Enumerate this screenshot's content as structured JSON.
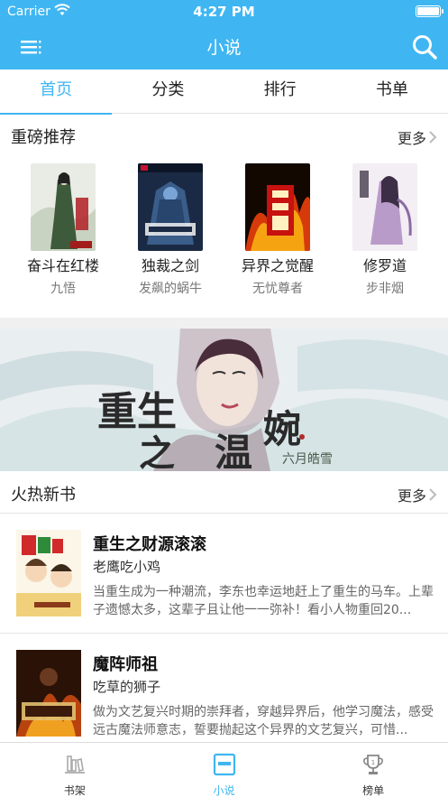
{
  "status_bar": {
    "carrier": "Carrier",
    "time": "4:27 PM"
  },
  "nav": {
    "title": "小说"
  },
  "tabs": [
    {
      "label": "首页",
      "active": true
    },
    {
      "label": "分类",
      "active": false
    },
    {
      "label": "排行",
      "active": false
    },
    {
      "label": "书单",
      "active": false
    }
  ],
  "featured": {
    "title": "重磅推荐",
    "more": "更多",
    "books": [
      {
        "title": "奋斗在红楼",
        "author": "九悟"
      },
      {
        "title": "独裁之剑",
        "author": "发飙的蜗牛"
      },
      {
        "title": "异界之觉醒",
        "author": "无忧尊者"
      },
      {
        "title": "修罗道",
        "author": "步非烟"
      }
    ]
  },
  "banner": {
    "title_part1": "重生",
    "title_part2": "之",
    "title_part3": "温",
    "title_part4": "婉",
    "author": "六月皓雪"
  },
  "hot": {
    "title": "火热新书",
    "more": "更多",
    "books": [
      {
        "title": "重生之财源滚滚",
        "author": "老鹰吃小鸡",
        "desc": "当重生成为一种潮流，李东也幸运地赶上了重生的马车。上辈子遗憾太多，这辈子且让他一一弥补！看小人物重回20..."
      },
      {
        "title": "魔阵师祖",
        "author": "吃草的狮子",
        "desc": "做为文艺复兴时期的崇拜者，穿越异界后，他学习魔法，感受远古魔法师意志，誓要抛起这个异界的文艺复兴，可惜..."
      }
    ]
  },
  "tabbar": [
    {
      "label": "书架",
      "active": false
    },
    {
      "label": "小说",
      "active": true
    },
    {
      "label": "榜单",
      "active": false
    }
  ],
  "colors": {
    "accent": "#3fb6f2",
    "gap": "#f0f0f0"
  }
}
